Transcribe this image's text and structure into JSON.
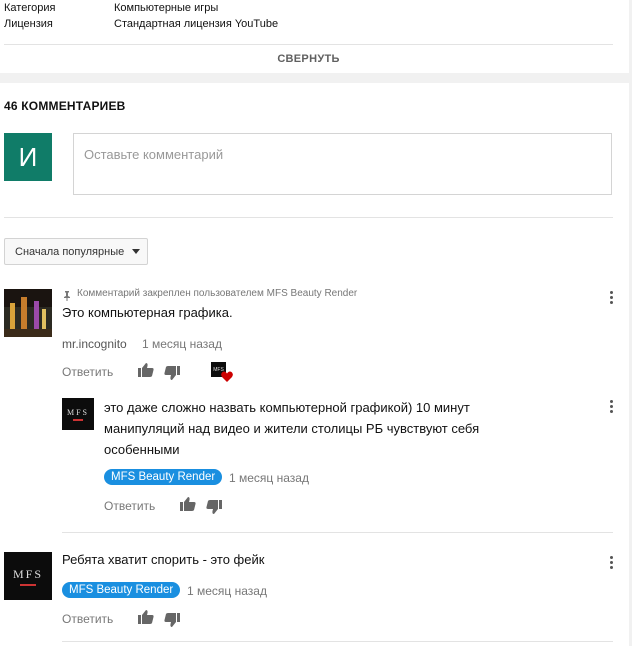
{
  "details": [
    {
      "label": "Категория",
      "value": "Компьютерные игры"
    },
    {
      "label": "Лицензия",
      "value": "Стандартная лицензия YouTube"
    }
  ],
  "collapse_label": "СВЕРНУТЬ",
  "comments_count": "46 КОММЕНТАРИЕВ",
  "user_avatar_letter": "И",
  "comment_input": {
    "placeholder": "Оставьте комментарий",
    "value": ""
  },
  "sort_label": "Сначала популярные",
  "comments": [
    {
      "pinned_text": "Комментарий закреплен пользователем MFS Beauty Render",
      "text": "Это компьютерная графика.",
      "author": "mr.incognito",
      "time": "1 месяц назад",
      "reply_label": "Ответить",
      "hearted": true
    },
    {
      "text_lines": [
        "это даже сложно назвать компьютерной графикой) 10 минут",
        "манипуляций над видео и  жители столицы РБ чувствуют себя",
        "особенными"
      ],
      "author": "MFS Beauty Render",
      "time": "1 месяц назад",
      "reply_label": "Ответить"
    },
    {
      "text": "Ребята хватит спорить - это фейк",
      "author": "MFS Beauty Render",
      "time": "1 месяц назад",
      "reply_label": "Ответить"
    }
  ],
  "logo_text": "MFS",
  "colors": {
    "avatar_bg": "#107c68",
    "badge_bg": "#1a8fe0",
    "heart": "#cc0000"
  }
}
